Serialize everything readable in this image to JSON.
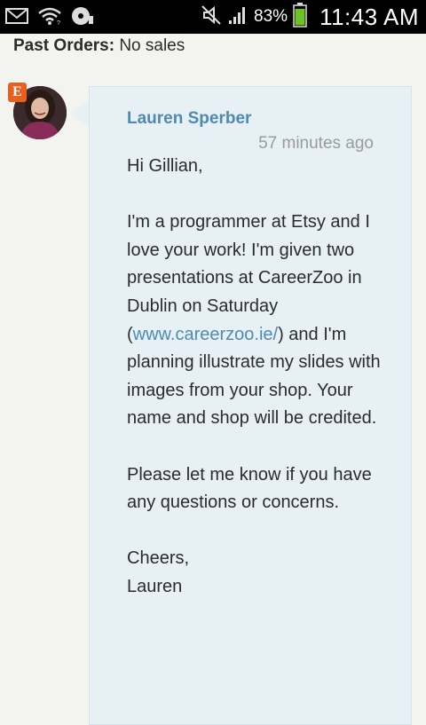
{
  "status_bar": {
    "battery_percent": "83%",
    "time": "11:43 AM",
    "icons": [
      "mail-icon",
      "wifi-icon",
      "disc-icon",
      "mute-icon",
      "signal-icon",
      "battery-icon"
    ]
  },
  "past_orders": {
    "label": "Past Orders:",
    "value": "No sales"
  },
  "message": {
    "badge": "E",
    "sender": "Lauren Sperber",
    "timestamp": "57 minutes ago",
    "greeting": "Hi Gillian,",
    "para1_before": "I'm a programmer at Etsy and I love your work! I'm given two presentations at CareerZoo in Dublin on Saturday (",
    "para1_link": "www.careerzoo.ie/",
    "para1_after": ") and I'm planning illustrate my slides with images from your shop. Your name and shop will be credited.",
    "para2": "Please let me know if you have any questions or concerns.",
    "signoff": "Cheers,",
    "signature": "Lauren"
  },
  "colors": {
    "accent": "#4f8ab0",
    "bubble": "#e7f1f5",
    "etsy": "#e8601c",
    "background": "#f3f3ef"
  }
}
